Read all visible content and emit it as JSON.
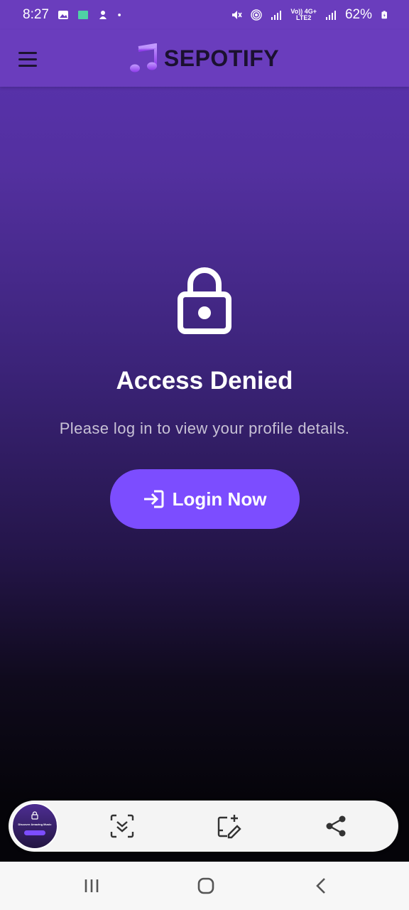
{
  "status_bar": {
    "time": "8:27",
    "battery": "62%",
    "network_top": "Vo)) 4G+",
    "network_bottom": "LTE2"
  },
  "app": {
    "title": "SEPOTIFY",
    "logo_icon": "music-note-icon",
    "menu_icon": "hamburger-menu-icon"
  },
  "main": {
    "icon": "lock-icon",
    "title": "Access Denied",
    "subtitle": "Please log in to view your profile details.",
    "login_button": "Login Now",
    "login_icon": "login-arrow-icon"
  },
  "capture_toolbar": {
    "thumbnail_title": "Discover Amazing Music"
  },
  "colors": {
    "app_bar": "#6a3dbd",
    "accent": "#7c4dff",
    "gradient_top": "#5b33b3",
    "gradient_bottom": "#050409"
  }
}
